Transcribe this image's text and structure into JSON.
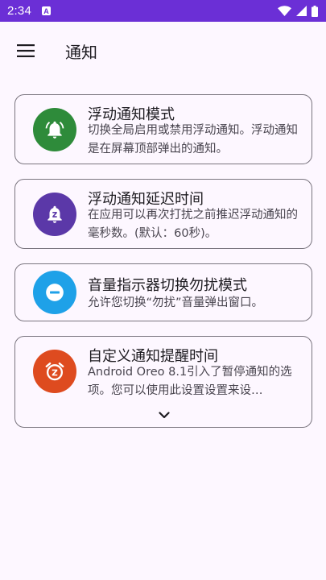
{
  "status_bar": {
    "time": "2:34",
    "notification_glyph": "A",
    "icons": [
      "wifi-icon",
      "signal-icon",
      "battery-icon"
    ],
    "background": "#6b2fd6"
  },
  "app_bar": {
    "title": "通知",
    "menu_icon": "menu-icon"
  },
  "cards": [
    {
      "title": "浮动通知模式",
      "description": "切换全局启用或禁用浮动通知。浮动通知是在屏幕顶部弹出的通知。",
      "icon": "bell-ring-icon",
      "icon_color": "#2e8b3a"
    },
    {
      "title": "浮动通知延迟时间",
      "description": "在应用可以再次打扰之前推迟浮动通知的毫秒数。(默认：60秒)。",
      "icon": "bell-snooze-icon",
      "icon_color": "#5b38a8"
    },
    {
      "title": "音量指示器切换勿扰模式",
      "description": "允许您切换“勿扰”音量弹出窗口。",
      "icon": "do-not-disturb-icon",
      "icon_color": "#1ea1e8"
    },
    {
      "title": "自定义通知提醒时间",
      "description": "Android Oreo 8.1引入了暂停通知的选项。您可以使用此设置设置来设…",
      "icon": "alarm-snooze-icon",
      "icon_color": "#de4b1f",
      "expand_icon": "chevron-down-icon"
    }
  ]
}
